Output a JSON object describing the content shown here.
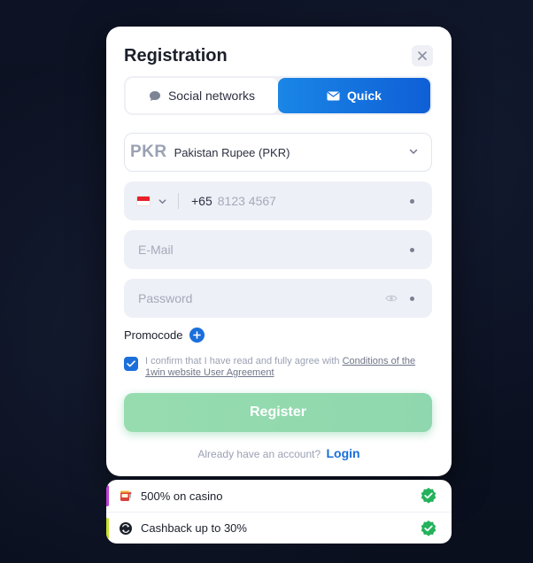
{
  "modal": {
    "title": "Registration",
    "close_icon": "close-icon"
  },
  "tabs": [
    {
      "label": "Social networks",
      "icon": "chat-bubble-icon",
      "active": false
    },
    {
      "label": "Quick",
      "icon": "envelope-icon",
      "active": true
    }
  ],
  "currency": {
    "code": "PKR",
    "name": "Pakistan Rupee (PKR)"
  },
  "phone": {
    "country_flag": "singapore-flag-icon",
    "prefix": "+65",
    "placeholder": "8123 4567"
  },
  "email": {
    "placeholder": "E-Mail"
  },
  "password": {
    "placeholder": "Password"
  },
  "promocode": {
    "label": "Promocode"
  },
  "agreement": {
    "checked": true,
    "text": "I confirm that I have read and fully agree with ",
    "link": "Conditions of the 1win website User Agreement"
  },
  "register": {
    "label": "Register"
  },
  "login_prompt": {
    "text": "Already have an account?",
    "link": "Login"
  },
  "bonuses": [
    {
      "text": "500% on casino",
      "icon": "slot-machine-icon",
      "accent": "#c03fd6"
    },
    {
      "text": "Cashback up to 30%",
      "icon": "cashback-icon",
      "accent": "#c6e22a"
    }
  ],
  "colors": {
    "primary": "#1a6fdb",
    "register_green": "#8fd7ae",
    "check_green": "#24b25b"
  }
}
